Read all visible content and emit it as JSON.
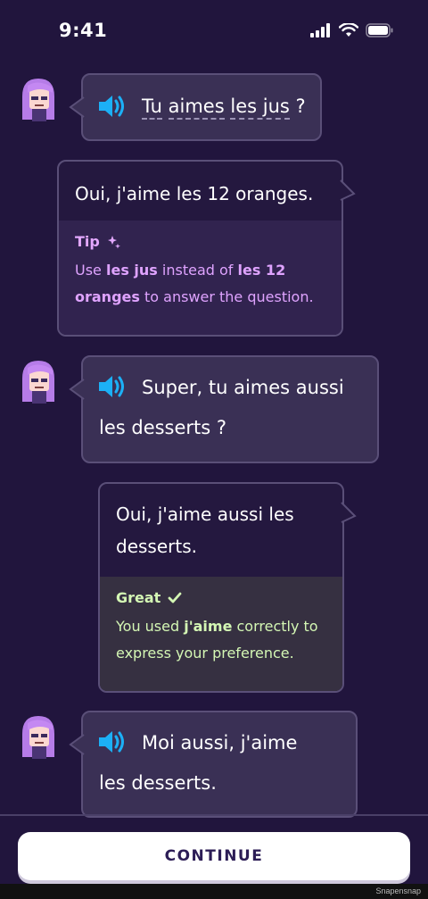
{
  "status_bar": {
    "time": "9:41"
  },
  "messages": [
    {
      "type": "prompt",
      "parts": [
        {
          "text": "Tu",
          "dotted": true
        },
        {
          "text": " "
        },
        {
          "text": "aimes",
          "dotted": true
        },
        {
          "text": " "
        },
        {
          "text": "les jus",
          "dotted": true
        },
        {
          "text": " ?"
        }
      ]
    },
    {
      "type": "answer",
      "text": "Oui, j'aime les 12 oranges.",
      "feedback": {
        "title": "Tip",
        "text_parts": [
          {
            "text": "Use "
          },
          {
            "text": "les jus",
            "bold": true
          },
          {
            "text": " instead of "
          },
          {
            "text": "les 12 oranges",
            "bold": true
          },
          {
            "text": " to answer the question."
          }
        ]
      }
    },
    {
      "type": "prompt",
      "line1": "Super, tu aimes aussi",
      "line2": "les desserts ?"
    },
    {
      "type": "answer",
      "line1": "Oui, j'aime aussi les",
      "line2": "desserts.",
      "feedback": {
        "title": "Great",
        "text_parts": [
          {
            "text": "You used "
          },
          {
            "text": "j'aime",
            "bold": true
          },
          {
            "text": " correctly to express your preference."
          }
        ]
      }
    },
    {
      "type": "prompt",
      "line1": "Moi aussi, j'aime",
      "line2": "les desserts."
    }
  ],
  "continue_label": "CONTINUE",
  "watermark": "Snapensnap",
  "colors": {
    "background": "#21153d",
    "bubble": "#3a3055",
    "tip": "#dfa3ff",
    "great": "#d4f7b4",
    "speaker": "#1cb0f6"
  }
}
